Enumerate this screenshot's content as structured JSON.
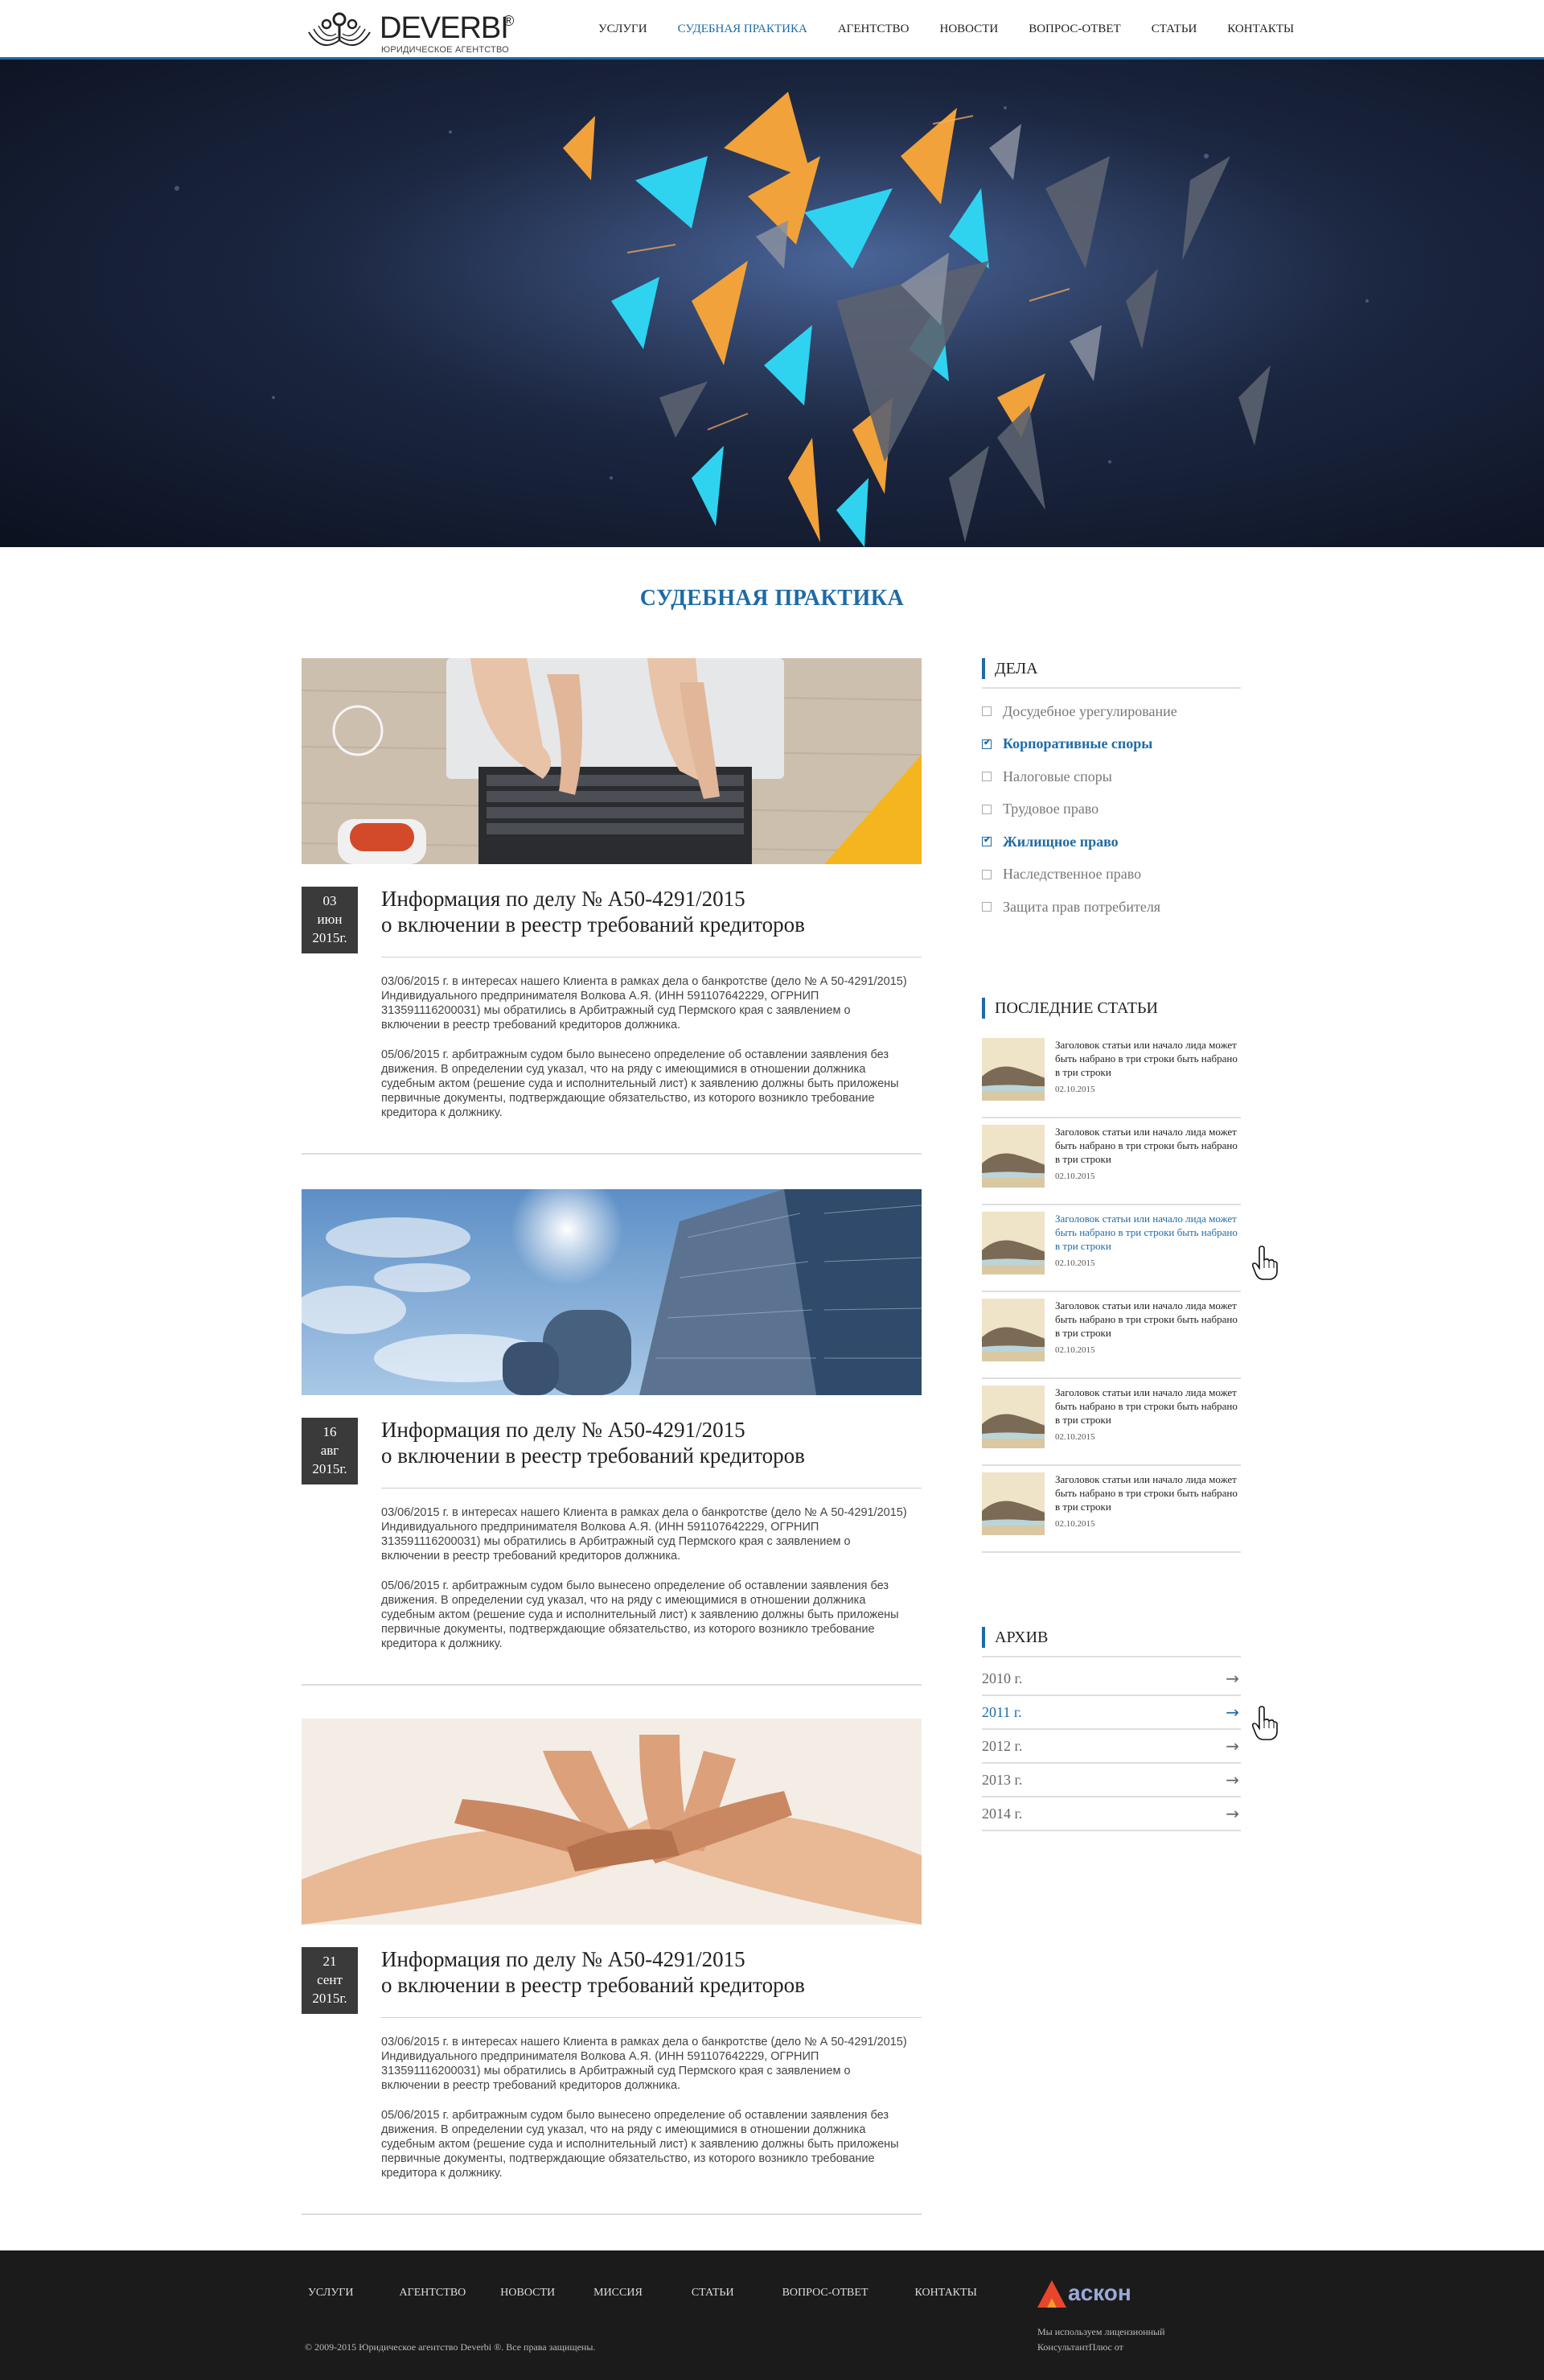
{
  "header": {
    "logo_name": "DEVERBI",
    "logo_reg": "®",
    "logo_sub": "ЮРИДИЧЕСКОЕ АГЕНТСТВО",
    "nav": [
      "УСЛУГИ",
      "СУДЕБНАЯ ПРАКТИКА",
      "АГЕНТСТВО",
      "НОВОСТИ",
      "ВОПРОС-ОТВЕТ",
      "СТАТЬИ",
      "КОНТАКТЫ"
    ],
    "active_nav": "СУДЕБНАЯ ПРАКТИКА"
  },
  "page_title": "СУДЕБНАЯ ПРАКТИКА",
  "articles": [
    {
      "day": "03",
      "month": "июн",
      "year": "2015г.",
      "title_line1": "Информация по делу № А50-4291/2015",
      "title_line2": "о включении в реестр требований кредиторов",
      "p1": "03/06/2015 г. в интересах нашего Клиента в рамках дела о банкротстве (дело № А 50-4291/2015) Индивидуального предпринимателя Волкова А.Я. (ИНН 591107642229, ОГРНИП 313591116200031) мы обратились в Арбитражный суд Пермского края с заявлением о включении в реестр требований кредиторов должника.",
      "p2": "05/06/2015 г. арбитражным судом было вынесено определение об оставлении заявления без движения. В определении суд указал, что на ряду с имеющимися в отношении должника судебным актом (решение суда и исполнительный лист) к заявлению должны быть приложены первичные документы, подтверждающие обязательство, из которого возникло требование кредитора к должнику."
    },
    {
      "day": "16",
      "month": "авг",
      "year": "2015г.",
      "title_line1": "Информация по делу № А50-4291/2015",
      "title_line2": "о включении в реестр требований кредиторов",
      "p1": "03/06/2015 г. в интересах нашего Клиента в рамках дела о банкротстве (дело № А 50-4291/2015) Индивидуального предпринимателя Волкова А.Я. (ИНН 591107642229, ОГРНИП 313591116200031) мы обратились в Арбитражный суд Пермского края с заявлением о включении в реестр требований кредиторов должника.",
      "p2": "05/06/2015 г. арбитражным судом было вынесено определение об оставлении заявления без движения. В определении суд указал, что на ряду с имеющимися в отношении должника судебным актом (решение суда и исполнительный лист) к заявлению должны быть приложены первичные документы, подтверждающие обязательство, из которого возникло требование кредитора к должнику."
    },
    {
      "day": "21",
      "month": "сент",
      "year": "2015г.",
      "title_line1": "Информация по делу № А50-4291/2015",
      "title_line2": "о включении в реестр требований кредиторов",
      "p1": "03/06/2015 г. в интересах нашего Клиента в рамках дела о банкротстве (дело № А 50-4291/2015) Индивидуального предпринимателя Волкова А.Я. (ИНН 591107642229, ОГРНИП 313591116200031) мы обратились в Арбитражный суд Пермского края с заявлением о включении в реестр требований кредиторов должника.",
      "p2": "05/06/2015 г. арбитражным судом было вынесено определение об оставлении заявления без движения. В определении суд указал, что на ряду с имеющимися в отношении должника судебным актом (решение суда и исполнительный лист) к заявлению должны быть приложены первичные документы, подтверждающие обязательство, из которого возникло требование кредитора к должнику."
    }
  ],
  "sidebar": {
    "cases_title": "ДЕЛА",
    "categories": [
      {
        "label": "Досудебное урегулирование",
        "checked": false
      },
      {
        "label": "Корпоративные споры",
        "checked": true
      },
      {
        "label": "Налоговые споры",
        "checked": false
      },
      {
        "label": "Трудовое право",
        "checked": false
      },
      {
        "label": "Жилищное право",
        "checked": true
      },
      {
        "label": "Наследственное право",
        "checked": false
      },
      {
        "label": "Защита прав потребителя",
        "checked": false
      }
    ],
    "latest_title": "ПОСЛЕДНИЕ СТАТЬИ",
    "posts": [
      {
        "title": "Заголовок статьи или  начало лида может быть набрано в три строки быть набрано в три строки",
        "date": "02.10.2015"
      },
      {
        "title": "Заголовок статьи или  начало лида может быть набрано в три строки быть набрано в три строки",
        "date": "02.10.2015"
      },
      {
        "title": "Заголовок статьи или  начало лида может быть набрано в три строки быть набрано в три строки",
        "date": "02.10.2015"
      },
      {
        "title": "Заголовок статьи или  начало лида может быть набрано в три строки быть набрано в три строки",
        "date": "02.10.2015"
      },
      {
        "title": "Заголовок статьи или  начало лида может быть набрано в три строки быть набрано в три строки",
        "date": "02.10.2015"
      },
      {
        "title": "Заголовок статьи или  начало лида может быть набрано в три строки быть набрано в три строки",
        "date": "02.10.2015"
      }
    ],
    "archive_title": "АРХИВ",
    "archive": [
      "2010 г.",
      "2011 г.",
      "2012 г.",
      "2013 г.",
      "2014 г."
    ],
    "archive_active": "2011 г."
  },
  "footer": {
    "nav": [
      "УСЛУГИ",
      "АГЕНТСТВО",
      "НОВОСТИ",
      "МИССИЯ",
      "СТАТЬИ",
      "ВОПРОС-ОТВЕТ",
      "КОНТАКТЫ"
    ],
    "copyright": "© 2009-2015 Юридическое агентство Deverbi ®. Все права защищены.",
    "partner_logo": "аскон",
    "partner_note": "Мы используем лицензионный КонсультантПлюс от"
  },
  "colors": {
    "accent": "#1e6ba6",
    "footer_bg": "#1b1b1b",
    "date_box": "#3a3a3a"
  }
}
